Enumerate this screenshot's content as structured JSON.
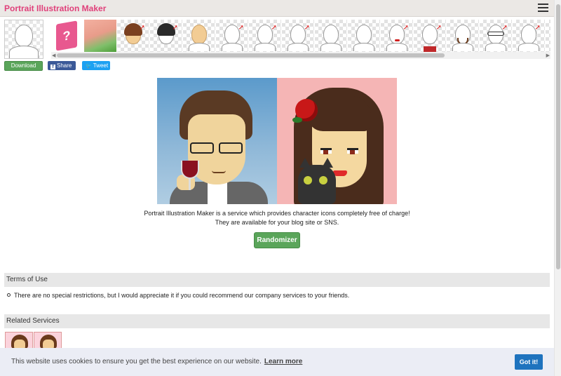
{
  "header": {
    "brand": "Portrait Illustration Maker"
  },
  "toolbar": {
    "download_label": "Download",
    "share_label": "Share",
    "tweet_label": "Tweet",
    "share_icon_glyph": "f",
    "tweet_icon_glyph": "✎"
  },
  "parts_strip": {
    "items": [
      "help-book",
      "background",
      "hair-brown",
      "hair-black",
      "face-skin",
      "eyes",
      "eyes",
      "eyebrows",
      "nose",
      "mouth",
      "lips",
      "shirt",
      "beard",
      "glasses",
      "glasses",
      "earrings",
      "rose-accessory"
    ]
  },
  "intro": {
    "line1": "Portrait Illustration Maker is a service which provides character icons completely free of charge!",
    "line2": "They are available for your blog site or SNS."
  },
  "randomizer_label": "Randomizer",
  "terms": {
    "heading": "Terms of Use",
    "item": "There are no special restrictions, but I would appreciate it if you could recommend our company services to your friends."
  },
  "related": {
    "heading": "Related Services"
  },
  "cookie": {
    "text": "This website uses cookies to ensure you get the best experience on our website.",
    "learn_more": "Learn more",
    "got_it": "Got it!"
  },
  "colors": {
    "brand": "#e0407a",
    "download_green": "#5aa55a",
    "facebook_blue": "#3b5998",
    "twitter_blue": "#1da1f2",
    "cookie_button": "#1e73be"
  }
}
